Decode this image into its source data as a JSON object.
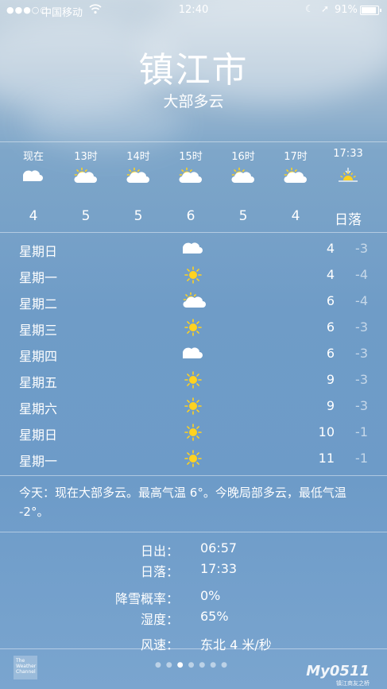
{
  "status_bar": {
    "signal": "●●●○○",
    "carrier": "中国移动",
    "time": "12:40",
    "battery": "91%",
    "battery_level": 0.91
  },
  "location": {
    "city": "镇江市",
    "condition": "大部多云"
  },
  "hourly": [
    {
      "time": "现在",
      "icon": "cloud",
      "temp": "4"
    },
    {
      "time": "13时",
      "icon": "sun-cloud",
      "temp": "5"
    },
    {
      "time": "14时",
      "icon": "sun-cloud",
      "temp": "5"
    },
    {
      "time": "15时",
      "icon": "sun-cloud",
      "temp": "6"
    },
    {
      "time": "16时",
      "icon": "sun-cloud",
      "temp": "5"
    },
    {
      "time": "17时",
      "icon": "sun-cloud",
      "temp": "4"
    },
    {
      "time": "17:33",
      "icon": "sunset",
      "temp": "日落"
    }
  ],
  "daily": [
    {
      "day": "星期日",
      "icon": "cloud",
      "high": "4",
      "low": "-3"
    },
    {
      "day": "星期一",
      "icon": "sun",
      "high": "4",
      "low": "-4"
    },
    {
      "day": "星期二",
      "icon": "sun-cloud",
      "high": "6",
      "low": "-4"
    },
    {
      "day": "星期三",
      "icon": "sun",
      "high": "6",
      "low": "-3"
    },
    {
      "day": "星期四",
      "icon": "cloud",
      "high": "6",
      "low": "-3"
    },
    {
      "day": "星期五",
      "icon": "sun",
      "high": "9",
      "low": "-3"
    },
    {
      "day": "星期六",
      "icon": "sun",
      "high": "9",
      "low": "-3"
    },
    {
      "day": "星期日",
      "icon": "sun",
      "high": "10",
      "low": "-1"
    },
    {
      "day": "星期一",
      "icon": "sun",
      "high": "11",
      "low": "-1"
    }
  ],
  "summary": "今天：现在大部多云。最高气温 6°。今晚局部多云，最低气温 -2°。",
  "details": [
    {
      "label": "日出：",
      "value": "06:57"
    },
    {
      "label": "日落：",
      "value": "17:33"
    },
    {
      "label": "降雪概率：",
      "value": "0%"
    },
    {
      "label": "湿度：",
      "value": "65%"
    },
    {
      "label": "风速：",
      "value": "东北 4 米/秒"
    }
  ],
  "footer": {
    "logo_text": "The Weather Channel",
    "watermark": "My0511",
    "watermark_sub": "镇江商友之桥",
    "page_count": 7,
    "active_page": 2
  },
  "colors": {
    "sun": "#ffd21f",
    "cloud": "#ffffff"
  }
}
